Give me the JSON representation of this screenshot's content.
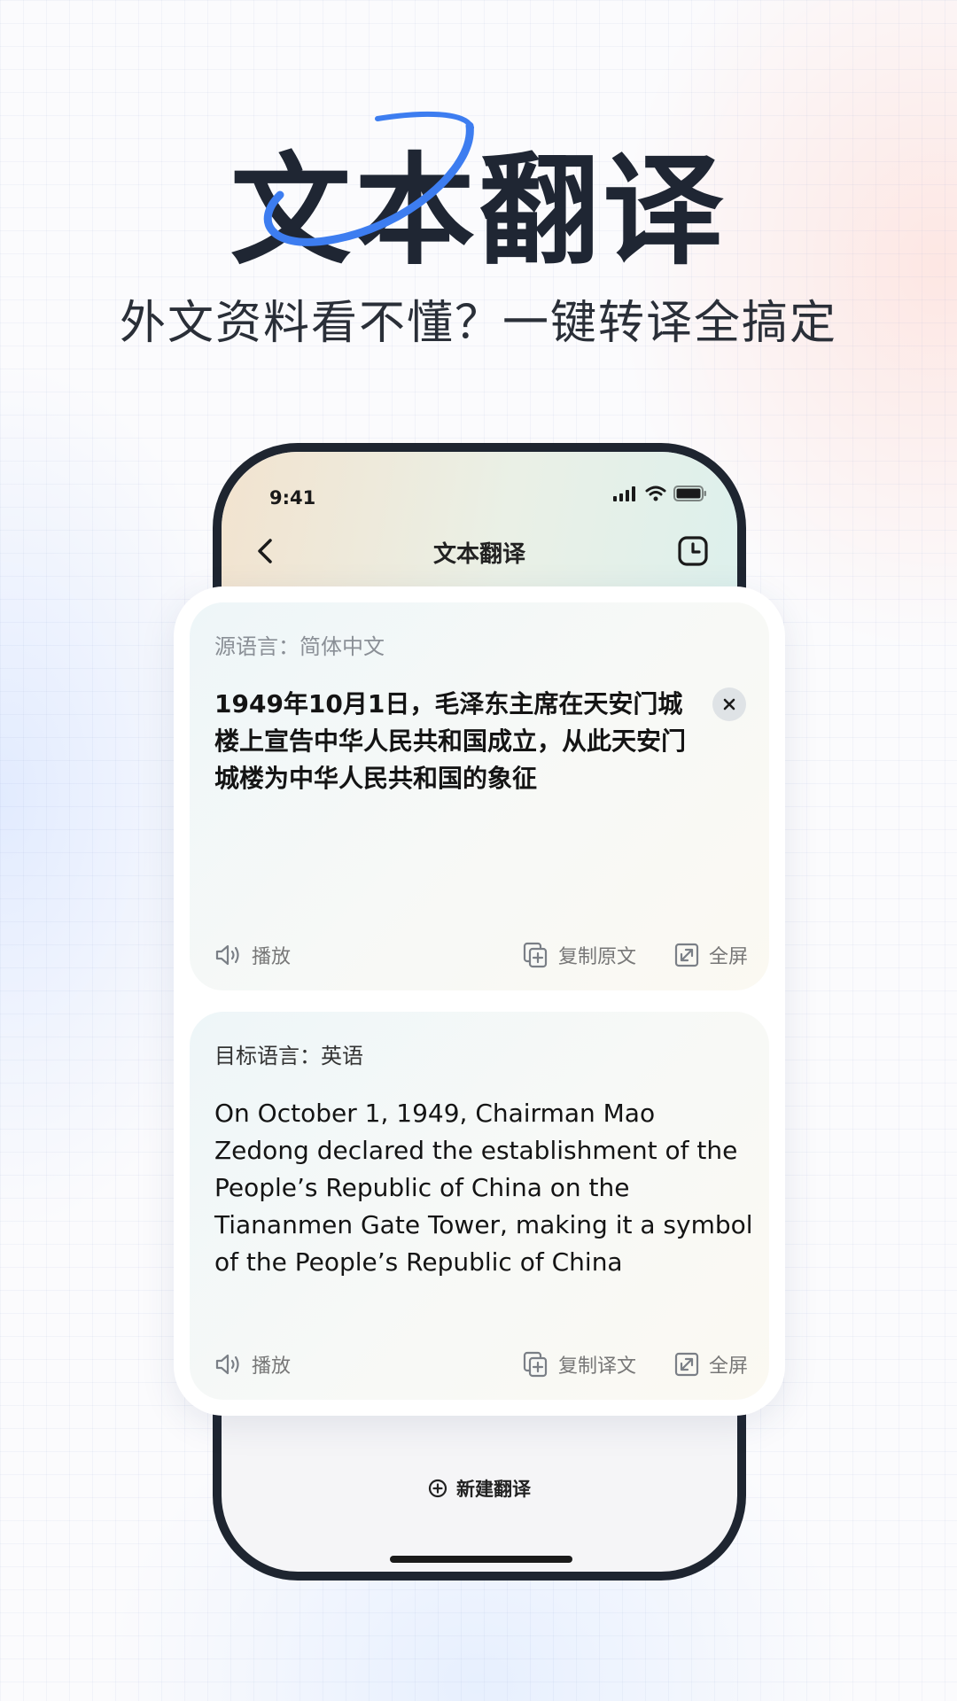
{
  "hero": {
    "title": "文本翻译",
    "subtitle": "外文资料看不懂？一键转译全搞定"
  },
  "status_bar": {
    "time": "9:41"
  },
  "nav": {
    "title": "文本翻译",
    "back_icon": "chevron-left-icon",
    "history_icon": "clock-icon"
  },
  "source_panel": {
    "language_label": "源语言：简体中文",
    "text": "1949年10月1日，毛泽东主席在天安门城楼上宣告中华人民共和国成立，从此天安门城楼为中华人民共和国的象征",
    "play_label": "播放",
    "copy_label": "复制原文",
    "fullscreen_label": "全屏"
  },
  "target_panel": {
    "language_label": "目标语言：英语",
    "text": "On October 1, 1949, Chairman Mao Zedong declared the establishment of the People’s Republic of China on the Tiananmen Gate Tower, making it a symbol of the People’s Republic of China",
    "play_label": "播放",
    "copy_label": "复制译文",
    "fullscreen_label": "全屏"
  },
  "footer": {
    "new_translation_label": "新建翻译"
  },
  "colors": {
    "accent_blue": "#3d7df0",
    "title_dark": "#1f2633",
    "phone_frame": "#1e2530"
  }
}
